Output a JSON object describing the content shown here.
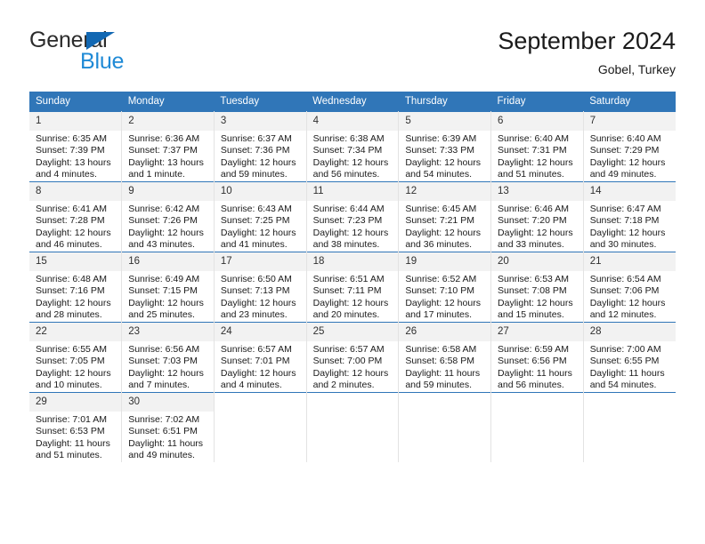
{
  "brand": {
    "name_part1": "General",
    "name_part2": "Blue",
    "triangle_icon": "blue-triangle-icon"
  },
  "header": {
    "title": "September 2024",
    "subtitle": "Gobel, Turkey"
  },
  "colors": {
    "header_blue": "#3076b8",
    "brand_dark": "#2b2b2b",
    "brand_blue": "#1f8ad6",
    "triangle_blue": "#1268b3",
    "daynum_bg": "#f2f2f2",
    "cell_border": "#e3e3e3"
  },
  "calendar": {
    "weekday_headers": [
      "Sunday",
      "Monday",
      "Tuesday",
      "Wednesday",
      "Thursday",
      "Friday",
      "Saturday"
    ],
    "weeks": [
      [
        {
          "day": "1",
          "sunrise": "Sunrise: 6:35 AM",
          "sunset": "Sunset: 7:39 PM",
          "daylight_line1": "Daylight: 13 hours",
          "daylight_line2": "and 4 minutes."
        },
        {
          "day": "2",
          "sunrise": "Sunrise: 6:36 AM",
          "sunset": "Sunset: 7:37 PM",
          "daylight_line1": "Daylight: 13 hours",
          "daylight_line2": "and 1 minute."
        },
        {
          "day": "3",
          "sunrise": "Sunrise: 6:37 AM",
          "sunset": "Sunset: 7:36 PM",
          "daylight_line1": "Daylight: 12 hours",
          "daylight_line2": "and 59 minutes."
        },
        {
          "day": "4",
          "sunrise": "Sunrise: 6:38 AM",
          "sunset": "Sunset: 7:34 PM",
          "daylight_line1": "Daylight: 12 hours",
          "daylight_line2": "and 56 minutes."
        },
        {
          "day": "5",
          "sunrise": "Sunrise: 6:39 AM",
          "sunset": "Sunset: 7:33 PM",
          "daylight_line1": "Daylight: 12 hours",
          "daylight_line2": "and 54 minutes."
        },
        {
          "day": "6",
          "sunrise": "Sunrise: 6:40 AM",
          "sunset": "Sunset: 7:31 PM",
          "daylight_line1": "Daylight: 12 hours",
          "daylight_line2": "and 51 minutes."
        },
        {
          "day": "7",
          "sunrise": "Sunrise: 6:40 AM",
          "sunset": "Sunset: 7:29 PM",
          "daylight_line1": "Daylight: 12 hours",
          "daylight_line2": "and 49 minutes."
        }
      ],
      [
        {
          "day": "8",
          "sunrise": "Sunrise: 6:41 AM",
          "sunset": "Sunset: 7:28 PM",
          "daylight_line1": "Daylight: 12 hours",
          "daylight_line2": "and 46 minutes."
        },
        {
          "day": "9",
          "sunrise": "Sunrise: 6:42 AM",
          "sunset": "Sunset: 7:26 PM",
          "daylight_line1": "Daylight: 12 hours",
          "daylight_line2": "and 43 minutes."
        },
        {
          "day": "10",
          "sunrise": "Sunrise: 6:43 AM",
          "sunset": "Sunset: 7:25 PM",
          "daylight_line1": "Daylight: 12 hours",
          "daylight_line2": "and 41 minutes."
        },
        {
          "day": "11",
          "sunrise": "Sunrise: 6:44 AM",
          "sunset": "Sunset: 7:23 PM",
          "daylight_line1": "Daylight: 12 hours",
          "daylight_line2": "and 38 minutes."
        },
        {
          "day": "12",
          "sunrise": "Sunrise: 6:45 AM",
          "sunset": "Sunset: 7:21 PM",
          "daylight_line1": "Daylight: 12 hours",
          "daylight_line2": "and 36 minutes."
        },
        {
          "day": "13",
          "sunrise": "Sunrise: 6:46 AM",
          "sunset": "Sunset: 7:20 PM",
          "daylight_line1": "Daylight: 12 hours",
          "daylight_line2": "and 33 minutes."
        },
        {
          "day": "14",
          "sunrise": "Sunrise: 6:47 AM",
          "sunset": "Sunset: 7:18 PM",
          "daylight_line1": "Daylight: 12 hours",
          "daylight_line2": "and 30 minutes."
        }
      ],
      [
        {
          "day": "15",
          "sunrise": "Sunrise: 6:48 AM",
          "sunset": "Sunset: 7:16 PM",
          "daylight_line1": "Daylight: 12 hours",
          "daylight_line2": "and 28 minutes."
        },
        {
          "day": "16",
          "sunrise": "Sunrise: 6:49 AM",
          "sunset": "Sunset: 7:15 PM",
          "daylight_line1": "Daylight: 12 hours",
          "daylight_line2": "and 25 minutes."
        },
        {
          "day": "17",
          "sunrise": "Sunrise: 6:50 AM",
          "sunset": "Sunset: 7:13 PM",
          "daylight_line1": "Daylight: 12 hours",
          "daylight_line2": "and 23 minutes."
        },
        {
          "day": "18",
          "sunrise": "Sunrise: 6:51 AM",
          "sunset": "Sunset: 7:11 PM",
          "daylight_line1": "Daylight: 12 hours",
          "daylight_line2": "and 20 minutes."
        },
        {
          "day": "19",
          "sunrise": "Sunrise: 6:52 AM",
          "sunset": "Sunset: 7:10 PM",
          "daylight_line1": "Daylight: 12 hours",
          "daylight_line2": "and 17 minutes."
        },
        {
          "day": "20",
          "sunrise": "Sunrise: 6:53 AM",
          "sunset": "Sunset: 7:08 PM",
          "daylight_line1": "Daylight: 12 hours",
          "daylight_line2": "and 15 minutes."
        },
        {
          "day": "21",
          "sunrise": "Sunrise: 6:54 AM",
          "sunset": "Sunset: 7:06 PM",
          "daylight_line1": "Daylight: 12 hours",
          "daylight_line2": "and 12 minutes."
        }
      ],
      [
        {
          "day": "22",
          "sunrise": "Sunrise: 6:55 AM",
          "sunset": "Sunset: 7:05 PM",
          "daylight_line1": "Daylight: 12 hours",
          "daylight_line2": "and 10 minutes."
        },
        {
          "day": "23",
          "sunrise": "Sunrise: 6:56 AM",
          "sunset": "Sunset: 7:03 PM",
          "daylight_line1": "Daylight: 12 hours",
          "daylight_line2": "and 7 minutes."
        },
        {
          "day": "24",
          "sunrise": "Sunrise: 6:57 AM",
          "sunset": "Sunset: 7:01 PM",
          "daylight_line1": "Daylight: 12 hours",
          "daylight_line2": "and 4 minutes."
        },
        {
          "day": "25",
          "sunrise": "Sunrise: 6:57 AM",
          "sunset": "Sunset: 7:00 PM",
          "daylight_line1": "Daylight: 12 hours",
          "daylight_line2": "and 2 minutes."
        },
        {
          "day": "26",
          "sunrise": "Sunrise: 6:58 AM",
          "sunset": "Sunset: 6:58 PM",
          "daylight_line1": "Daylight: 11 hours",
          "daylight_line2": "and 59 minutes."
        },
        {
          "day": "27",
          "sunrise": "Sunrise: 6:59 AM",
          "sunset": "Sunset: 6:56 PM",
          "daylight_line1": "Daylight: 11 hours",
          "daylight_line2": "and 56 minutes."
        },
        {
          "day": "28",
          "sunrise": "Sunrise: 7:00 AM",
          "sunset": "Sunset: 6:55 PM",
          "daylight_line1": "Daylight: 11 hours",
          "daylight_line2": "and 54 minutes."
        }
      ],
      [
        {
          "day": "29",
          "sunrise": "Sunrise: 7:01 AM",
          "sunset": "Sunset: 6:53 PM",
          "daylight_line1": "Daylight: 11 hours",
          "daylight_line2": "and 51 minutes."
        },
        {
          "day": "30",
          "sunrise": "Sunrise: 7:02 AM",
          "sunset": "Sunset: 6:51 PM",
          "daylight_line1": "Daylight: 11 hours",
          "daylight_line2": "and 49 minutes."
        },
        {
          "day": "",
          "sunrise": "",
          "sunset": "",
          "daylight_line1": "",
          "daylight_line2": ""
        },
        {
          "day": "",
          "sunrise": "",
          "sunset": "",
          "daylight_line1": "",
          "daylight_line2": ""
        },
        {
          "day": "",
          "sunrise": "",
          "sunset": "",
          "daylight_line1": "",
          "daylight_line2": ""
        },
        {
          "day": "",
          "sunrise": "",
          "sunset": "",
          "daylight_line1": "",
          "daylight_line2": ""
        },
        {
          "day": "",
          "sunrise": "",
          "sunset": "",
          "daylight_line1": "",
          "daylight_line2": ""
        }
      ]
    ]
  }
}
